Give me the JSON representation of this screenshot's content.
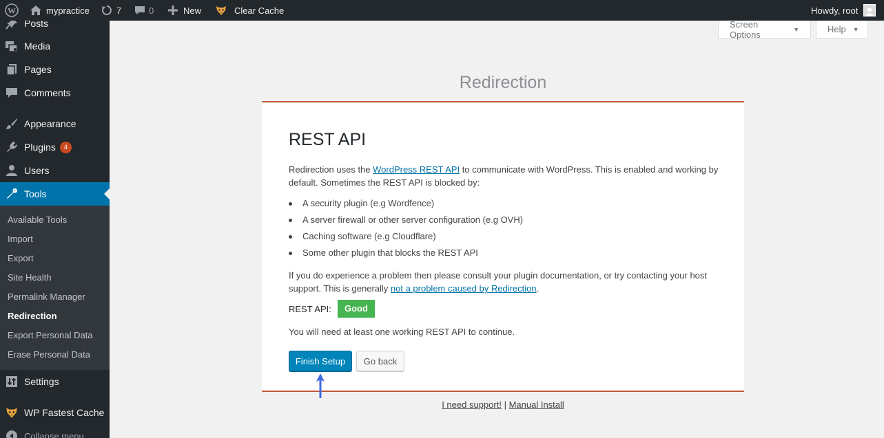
{
  "adminbar": {
    "site_name": "mypractice",
    "updates_count": "7",
    "comments_count": "0",
    "new_label": "New",
    "clear_cache_label": "Clear Cache",
    "howdy": "Howdy, root"
  },
  "sidebar": {
    "items": {
      "posts": "Posts",
      "media": "Media",
      "pages": "Pages",
      "comments": "Comments",
      "appearance": "Appearance",
      "plugins": "Plugins",
      "plugins_badge": "4",
      "users": "Users",
      "tools": "Tools",
      "settings": "Settings",
      "wp_fastest_cache": "WP Fastest Cache",
      "collapse": "Collapse menu"
    },
    "submenu": [
      "Available Tools",
      "Import",
      "Export",
      "Site Health",
      "Permalink Manager",
      "Redirection",
      "Export Personal Data",
      "Erase Personal Data"
    ],
    "current_submenu": "Redirection"
  },
  "screen_meta": {
    "screen_options": "Screen Options",
    "help": "Help"
  },
  "page": {
    "title": "Redirection"
  },
  "wizard": {
    "heading": "REST API",
    "intro_before_link": "Redirection uses the ",
    "intro_link": "WordPress REST API",
    "intro_after_link": " to communicate with WordPress. This is enabled and working by default. Sometimes the REST API is blocked by:",
    "bullets": [
      "A security plugin (e.g Wordfence)",
      "A server firewall or other server configuration (e.g OVH)",
      "Caching software (e.g Cloudflare)",
      "Some other plugin that blocks the REST API"
    ],
    "problem_before_link": "If you do experience a problem then please consult your plugin documentation, or try contacting your host support. This is generally ",
    "problem_link": "not a problem caused by Redirection",
    "problem_after_link": ".",
    "status_label": "REST API:",
    "status_value": "Good",
    "status_color": "#46b450",
    "continue_text": "You will need at least one working REST API to continue.",
    "finish_button": "Finish Setup",
    "back_button": "Go back"
  },
  "footer": {
    "support_link": "I need support!",
    "separator": "|",
    "manual_link": "Manual Install"
  },
  "colors": {
    "accent": "#0073aa",
    "primary_button": "#0085ba",
    "wizard_border": "#c1583a",
    "sidebar_bg": "#23282d",
    "annotation_arrow": "#4169e1"
  }
}
